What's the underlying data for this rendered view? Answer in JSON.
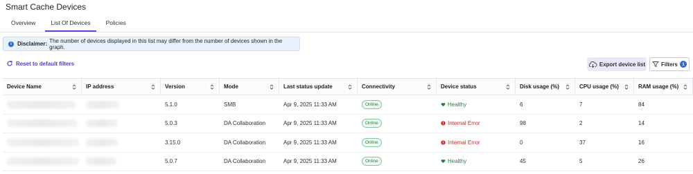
{
  "page": {
    "title": "Smart Cache Devices"
  },
  "tabs": [
    {
      "label": "Overview"
    },
    {
      "label": "List Of Devices"
    },
    {
      "label": "Policies"
    }
  ],
  "disclaimer": {
    "label": "Disclaimer:",
    "text": "The number of devices displayed in this list may differ from the number of devices shown in the graph."
  },
  "actions": {
    "reset_label": "Reset to default filters",
    "export_label": "Export device list",
    "filters_label": "Filters",
    "filters_count": "1"
  },
  "table": {
    "headers": [
      "Device Name",
      "IP address",
      "Version",
      "Mode",
      "Last status update",
      "Connectivity",
      "Device status",
      "Disk usage (%)",
      "CPU usage (%)",
      "RAM usage (%)"
    ],
    "rows": [
      {
        "version": "5.1.0",
        "mode": "SMB",
        "last_update": "Apr 9, 2025 11:33 AM",
        "connectivity": "Online",
        "status": "Healthy",
        "status_type": "healthy",
        "disk": "6",
        "cpu": "7",
        "ram": "84"
      },
      {
        "version": "5.0.3",
        "mode": "DA Collaboration",
        "last_update": "Apr 9, 2025 11:33 AM",
        "connectivity": "Online",
        "status": "Internal Error",
        "status_type": "error",
        "disk": "98",
        "cpu": "2",
        "ram": "14"
      },
      {
        "version": "3.15.0",
        "mode": "DA Collaboration",
        "last_update": "Apr 9, 2025 11:33 AM",
        "connectivity": "Online",
        "status": "Internal Error",
        "status_type": "error",
        "disk": "0",
        "cpu": "37",
        "ram": "16"
      },
      {
        "version": "5.0.7",
        "mode": "DA Collaboration",
        "last_update": "Apr 9, 2025 11:33 AM",
        "connectivity": "Online",
        "status": "Healthy",
        "status_type": "healthy",
        "disk": "45",
        "cpu": "5",
        "ram": "26"
      }
    ]
  },
  "colors": {
    "accent": "#6a3fd0",
    "link": "#5b3bc4",
    "healthy": "#2a7d45",
    "error": "#d02a2a",
    "info": "#2b6fd0"
  },
  "icons": [
    "info-icon",
    "reset-icon",
    "cloud-download-icon",
    "filter-icon",
    "sort-icon",
    "heart-icon",
    "error-icon"
  ]
}
